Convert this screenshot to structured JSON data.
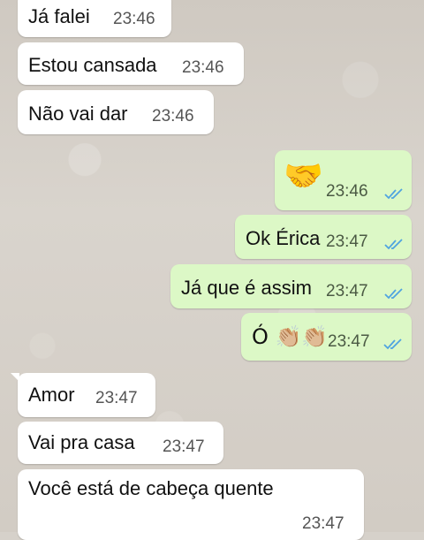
{
  "conversation": {
    "messages": [
      {
        "text": "Já falei",
        "time": "23:46",
        "direction": "incoming"
      },
      {
        "text": "Estou cansada",
        "time": "23:46",
        "direction": "incoming"
      },
      {
        "text": "Não vai dar",
        "time": "23:46",
        "direction": "incoming"
      },
      {
        "text": "🤝",
        "time": "23:46",
        "direction": "outgoing",
        "status": "read"
      },
      {
        "text": "Ok Érica",
        "time": "23:47",
        "direction": "outgoing",
        "status": "read"
      },
      {
        "text": "Já que é assim",
        "time": "23:47",
        "direction": "outgoing",
        "status": "read"
      },
      {
        "text": "Ó 👏🏼👏🏼",
        "time": "23:47",
        "direction": "outgoing",
        "status": "read"
      },
      {
        "text": "Amor",
        "time": "23:47",
        "direction": "incoming"
      },
      {
        "text": "Vai pra casa",
        "time": "23:47",
        "direction": "incoming"
      },
      {
        "text": "Você está de cabeça quente",
        "time": "23:47",
        "direction": "incoming"
      }
    ]
  },
  "colors": {
    "incoming_bubble": "#ffffff",
    "outgoing_bubble": "#dcf8c6",
    "read_ticks": "#4fa3e0",
    "wallpaper": "#d6d1ca"
  }
}
